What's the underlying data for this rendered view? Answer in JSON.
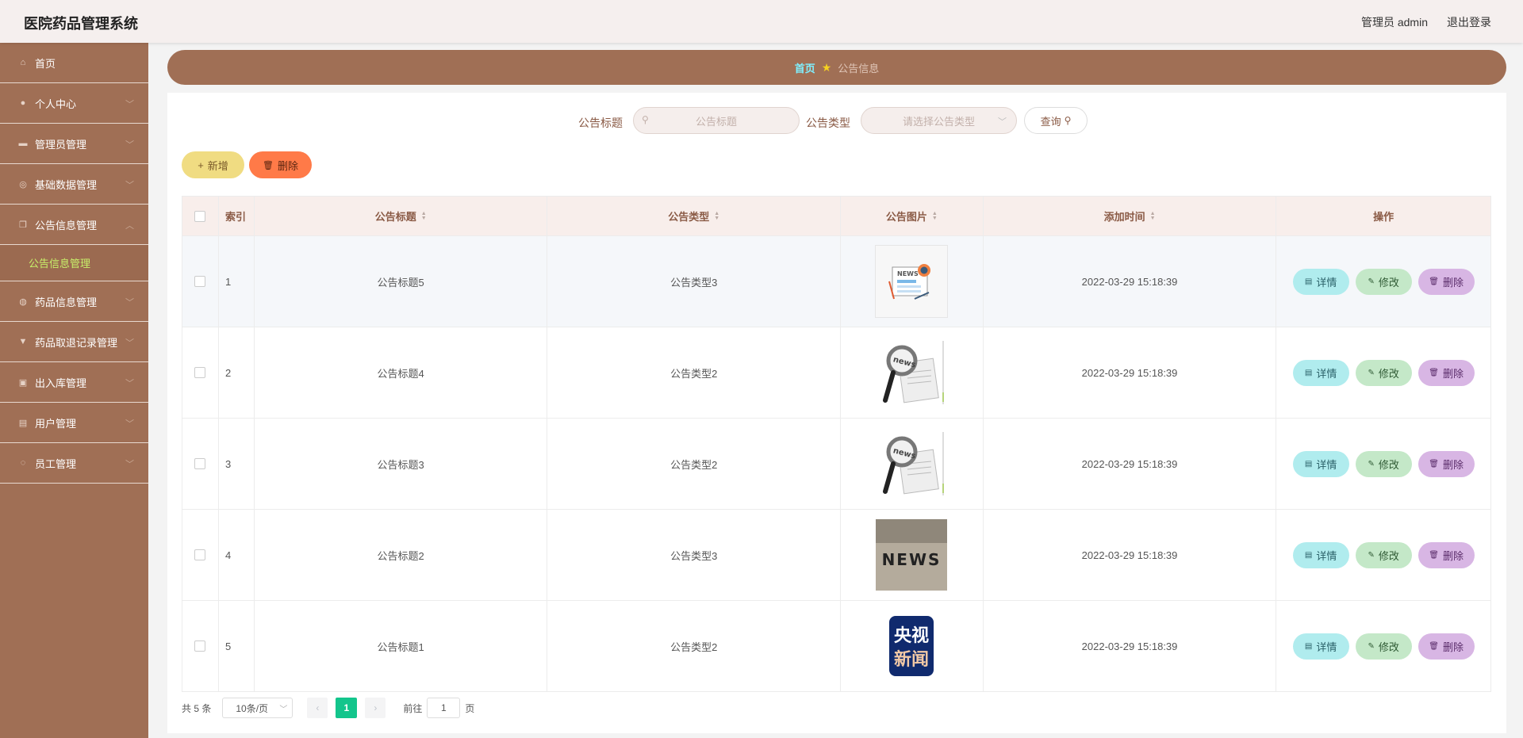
{
  "app": {
    "title": "医院药品管理系统",
    "user": "管理员 admin",
    "logout": "退出登录"
  },
  "sidebar": {
    "items": [
      {
        "label": "首页",
        "icon": "home-icon"
      },
      {
        "label": "个人中心",
        "icon": "user-icon"
      },
      {
        "label": "管理员管理",
        "icon": "admin-icon"
      },
      {
        "label": "基础数据管理",
        "icon": "database-icon"
      },
      {
        "label": "公告信息管理",
        "icon": "notice-icon"
      },
      {
        "label": "药品信息管理",
        "icon": "drug-icon"
      },
      {
        "label": "药品取退记录管理",
        "icon": "record-icon"
      },
      {
        "label": "出入库管理",
        "icon": "warehouse-icon"
      },
      {
        "label": "用户管理",
        "icon": "users-icon"
      },
      {
        "label": "员工管理",
        "icon": "staff-icon"
      }
    ],
    "submenu": {
      "label": "公告信息管理"
    }
  },
  "breadcrumb": {
    "home": "首页",
    "current": "公告信息"
  },
  "search": {
    "title_label": "公告标题",
    "title_placeholder": "公告标题",
    "type_label": "公告类型",
    "type_placeholder": "请选择公告类型",
    "query_button": "查询"
  },
  "actions": {
    "add": "新增",
    "delete": "删除"
  },
  "table": {
    "headers": [
      "索引",
      "公告标题",
      "公告类型",
      "公告图片",
      "添加时间",
      "操作"
    ],
    "rows": [
      {
        "index": "1",
        "title": "公告标题5",
        "type": "公告类型3",
        "image": "newspaper-illustration",
        "time": "2022-03-29 15:18:39"
      },
      {
        "index": "2",
        "title": "公告标题4",
        "type": "公告类型2",
        "image": "magnifier-news",
        "time": "2022-03-29 15:18:39"
      },
      {
        "index": "3",
        "title": "公告标题3",
        "type": "公告类型2",
        "image": "magnifier-news",
        "time": "2022-03-29 15:18:39"
      },
      {
        "index": "4",
        "title": "公告标题2",
        "type": "公告类型3",
        "image": "news-blocks",
        "time": "2022-03-29 15:18:39"
      },
      {
        "index": "5",
        "title": "公告标题1",
        "type": "公告类型2",
        "image": "cctv-news-logo",
        "time": "2022-03-29 15:18:39"
      }
    ],
    "ops": {
      "detail": "详情",
      "edit": "修改",
      "delete": "删除"
    }
  },
  "images": {
    "news_text": "NEWS",
    "news_small": "news",
    "cctv_line1": "央视",
    "cctv_line2": "新闻"
  },
  "pagination": {
    "total": "共 5 条",
    "page_size": "10条/页",
    "current_page": "1",
    "goto_label": "前往",
    "goto_value": "1",
    "page_unit": "页"
  },
  "colors": {
    "sidebar_bg": "#a06f55",
    "accent_green": "#13c58c",
    "submenu_active": "#c8f06a",
    "breadcrumb_home": "#7ff0ff"
  }
}
